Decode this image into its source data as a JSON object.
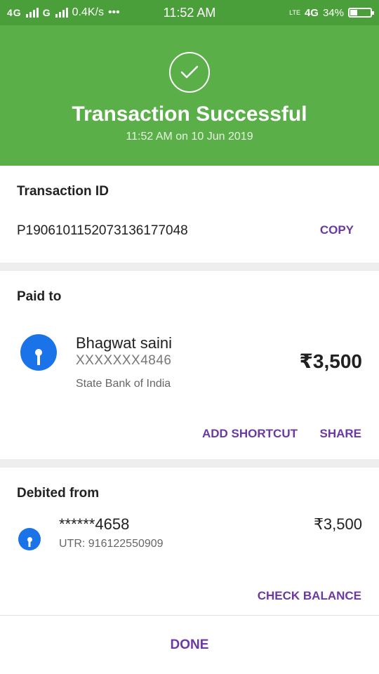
{
  "status_bar": {
    "network_left": "4G",
    "signal_left": "G",
    "speed": "0.4K/s",
    "more": "•••",
    "time": "11:52 AM",
    "volte": "LTE",
    "network_right": "4G",
    "battery": "34%",
    "battery_level": 0.34
  },
  "header": {
    "title": "Transaction Successful",
    "subtitle": "11:52 AM on 10 Jun 2019"
  },
  "transaction": {
    "label": "Transaction ID",
    "id": "P1906101152073136177048",
    "copy_label": "COPY"
  },
  "paid_to": {
    "label": "Paid to",
    "name": "Bhagwat saini",
    "account": "XXXXXXX4846",
    "bank": "State Bank of India",
    "amount": "₹3,500",
    "add_shortcut_label": "ADD SHORTCUT",
    "share_label": "SHARE"
  },
  "debited_from": {
    "label": "Debited from",
    "account": "******4658",
    "utr": "UTR: 916122550909",
    "amount": "₹3,500",
    "check_balance_label": "CHECK BALANCE"
  },
  "done_label": "DONE",
  "colors": {
    "header_green": "#5aaf49",
    "status_green": "#4b9f3a",
    "accent_purple": "#6a3aa2",
    "bank_blue": "#1a73e8"
  }
}
